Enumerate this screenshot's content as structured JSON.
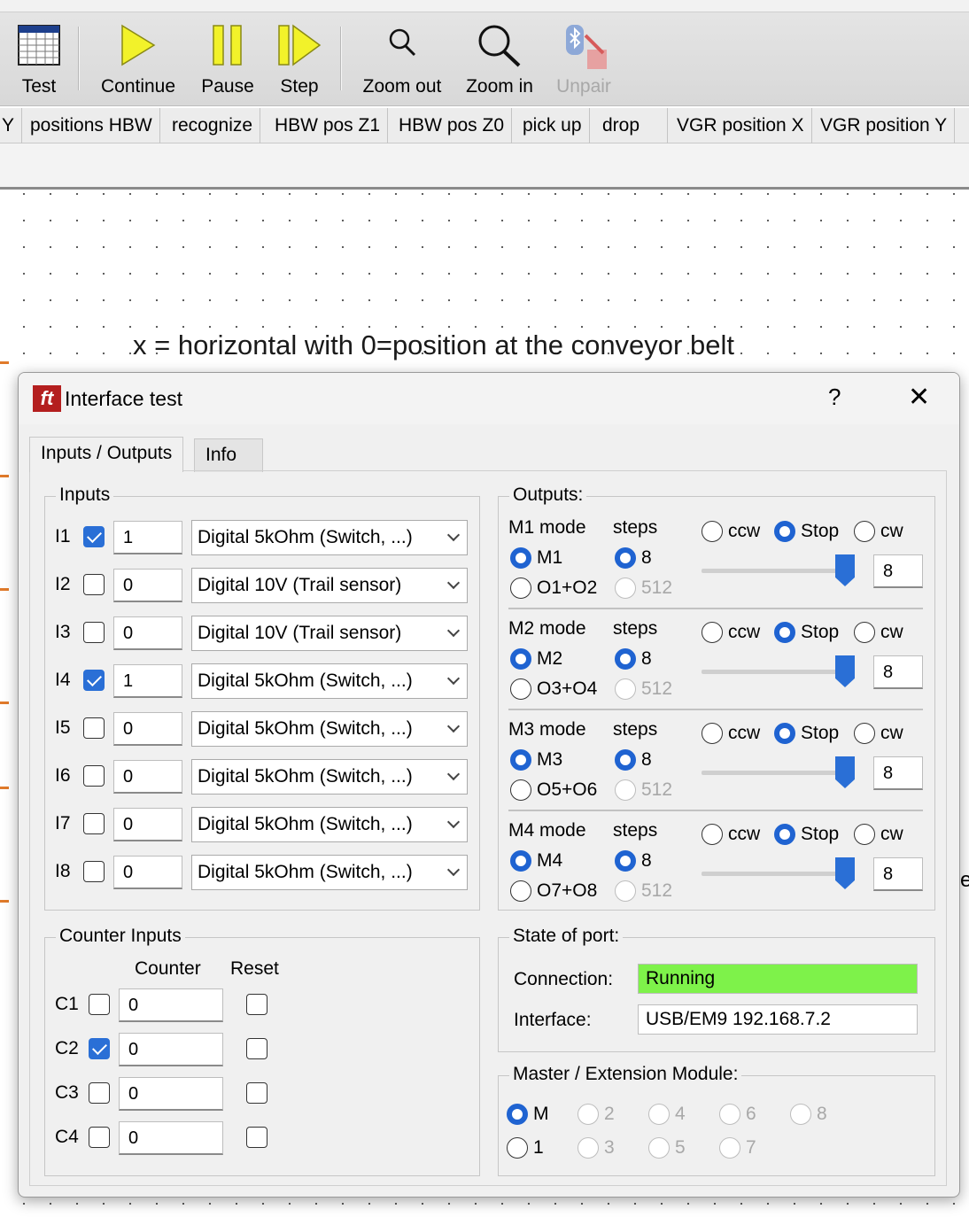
{
  "toolbar": {
    "test_label": "Test",
    "continue_label": "Continue",
    "pause_label": "Pause",
    "step_label": "Step",
    "zoom_out_label": "Zoom out",
    "zoom_in_label": "Zoom in",
    "unpair_label": "Unpair"
  },
  "program_tabs": [
    "Y",
    "positions HBW",
    "recognize",
    "HBW pos Z1",
    "HBW pos Z0",
    "pick up",
    "drop",
    "VGR position X",
    "VGR position Y"
  ],
  "canvas": {
    "text": "x = horizontal with 0=position at the conveyor belt",
    "edge_glyph": "e"
  },
  "dialog": {
    "title": "Interface test",
    "help": "?",
    "close": "✕",
    "tabs": [
      "Inputs / Outputs",
      "Info"
    ],
    "inputs_group": "Inputs",
    "inputs": [
      {
        "name": "I1",
        "checked": true,
        "value": "1",
        "mode": "Digital 5kOhm (Switch, ...)"
      },
      {
        "name": "I2",
        "checked": false,
        "value": "0",
        "mode": "Digital 10V (Trail sensor)"
      },
      {
        "name": "I3",
        "checked": false,
        "value": "0",
        "mode": "Digital 10V (Trail sensor)"
      },
      {
        "name": "I4",
        "checked": true,
        "value": "1",
        "mode": "Digital 5kOhm (Switch, ...)"
      },
      {
        "name": "I5",
        "checked": false,
        "value": "0",
        "mode": "Digital 5kOhm (Switch, ...)"
      },
      {
        "name": "I6",
        "checked": false,
        "value": "0",
        "mode": "Digital 5kOhm (Switch, ...)"
      },
      {
        "name": "I7",
        "checked": false,
        "value": "0",
        "mode": "Digital 5kOhm (Switch, ...)"
      },
      {
        "name": "I8",
        "checked": false,
        "value": "0",
        "mode": "Digital 5kOhm (Switch, ...)"
      }
    ],
    "outputs_group": "Outputs:",
    "steps_label": "steps",
    "ccw_label": "ccw",
    "stop_label": "Stop",
    "cw_label": "cw",
    "steps_8": "8",
    "steps_512": "512",
    "motors": [
      {
        "mode_label": "M1 mode",
        "motor_option": "M1",
        "pair_option": "O1+O2",
        "value": "8",
        "level": 0.9
      },
      {
        "mode_label": "M2 mode",
        "motor_option": "M2",
        "pair_option": "O3+O4",
        "value": "8",
        "level": 0.9
      },
      {
        "mode_label": "M3 mode",
        "motor_option": "M3",
        "pair_option": "O5+O6",
        "value": "8",
        "level": 0.9
      },
      {
        "mode_label": "M4 mode",
        "motor_option": "M4",
        "pair_option": "O7+O8",
        "value": "8",
        "level": 0.9
      }
    ],
    "counter_group": "Counter Inputs",
    "counter_header": "Counter",
    "reset_header": "Reset",
    "counters": [
      {
        "name": "C1",
        "checked": false,
        "value": "0"
      },
      {
        "name": "C2",
        "checked": true,
        "value": "0"
      },
      {
        "name": "C3",
        "checked": false,
        "value": "0"
      },
      {
        "name": "C4",
        "checked": false,
        "value": "0"
      }
    ],
    "state_group": "State of port:",
    "connection_label": "Connection:",
    "connection_value": "Running",
    "connection_color": "#7ef24a",
    "interface_label": "Interface:",
    "interface_value": "USB/EM9 192.168.7.2",
    "master_group": "Master / Extension Module:",
    "modules_row1": [
      "M",
      "2",
      "4",
      "6",
      "8"
    ],
    "modules_row2": [
      "1",
      "3",
      "5",
      "7"
    ]
  }
}
